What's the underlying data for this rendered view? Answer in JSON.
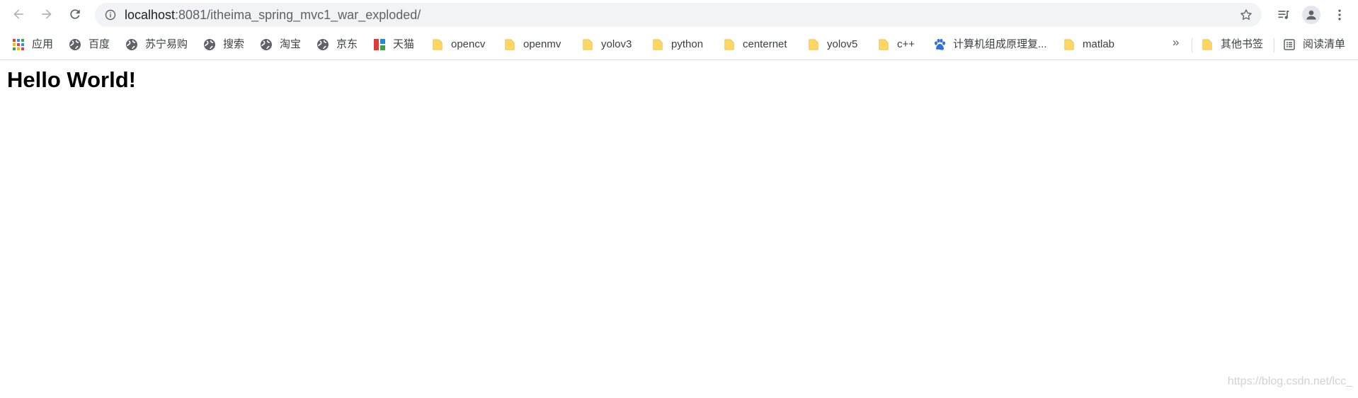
{
  "browser": {
    "url_host": "localhost",
    "url_path": ":8081/itheima_spring_mvc1_war_exploded/"
  },
  "bookmarks": {
    "items": [
      {
        "label": "应用",
        "icon": "apps-grid-icon"
      },
      {
        "label": "百度",
        "icon": "globe-icon"
      },
      {
        "label": "苏宁易购",
        "icon": "globe-icon"
      },
      {
        "label": "搜索",
        "icon": "globe-icon"
      },
      {
        "label": "淘宝",
        "icon": "globe-icon"
      },
      {
        "label": "京东",
        "icon": "globe-icon"
      },
      {
        "label": "天猫",
        "icon": "tmall-icon"
      },
      {
        "label": "opencv",
        "icon": "folder-icon"
      },
      {
        "label": "openmv",
        "icon": "folder-icon"
      },
      {
        "label": "yolov3",
        "icon": "folder-icon"
      },
      {
        "label": "python",
        "icon": "folder-icon"
      },
      {
        "label": "centernet",
        "icon": "folder-icon"
      },
      {
        "label": "yolov5",
        "icon": "folder-icon"
      },
      {
        "label": "c++",
        "icon": "folder-icon"
      },
      {
        "label": "计算机组成原理复...",
        "icon": "baidu-paw-icon"
      },
      {
        "label": "matlab",
        "icon": "folder-icon"
      }
    ],
    "overflow_label": "»",
    "other_bookmarks": "其他书签",
    "reading_list": "阅读清单"
  },
  "page": {
    "heading": "Hello World!",
    "watermark": "https://blog.csdn.net/lcc_"
  },
  "colors": {
    "omnibox_bg": "#f1f3f4",
    "folder_yellow": "#fdd663",
    "globe_gray": "#5f6368",
    "text": "#3c4043"
  }
}
